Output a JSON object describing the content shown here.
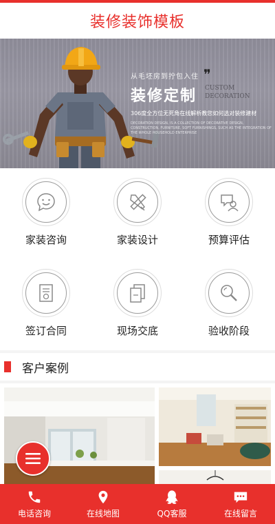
{
  "header": {
    "title": "装修装饰模板"
  },
  "banner": {
    "tagline": "从毛坯房到拧包入住",
    "quote_mark": "❞",
    "headline": "装修定制",
    "english_line1": "CUSTOM",
    "english_line2": "DECORATION",
    "description": "306度全方位无死角在线解析教您如何选对装修建材",
    "fine_print": "DECORATION DESIGN, IS A COLLECTION OF DECORATIVE DESIGN, CONSTRUCTION, FURNITURE, SOFT FURNISHINGS, SUCH AS THE INTEGRATION OF THE WHOLE HOUSEHOLD ENTERPRISE"
  },
  "services": [
    {
      "label": "家装咨询",
      "icon": "chat-icon"
    },
    {
      "label": "家装设计",
      "icon": "design-tools-icon"
    },
    {
      "label": "预算评估",
      "icon": "budget-icon"
    },
    {
      "label": "签订合同",
      "icon": "contract-icon"
    },
    {
      "label": "现场交底",
      "icon": "documents-icon"
    },
    {
      "label": "验收阶段",
      "icon": "magnifier-icon"
    }
  ],
  "cases": {
    "title": "客户案例"
  },
  "footer": [
    {
      "label": "电话咨询",
      "icon": "phone-icon"
    },
    {
      "label": "在线地图",
      "icon": "map-pin-icon"
    },
    {
      "label": "QQ客服",
      "icon": "qq-icon"
    },
    {
      "label": "在线留言",
      "icon": "message-icon"
    }
  ],
  "colors": {
    "accent": "#e8302c"
  }
}
